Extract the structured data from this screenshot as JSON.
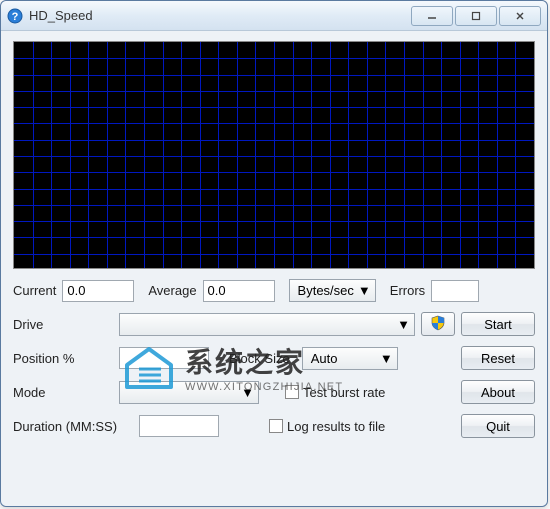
{
  "window": {
    "title": "HD_Speed"
  },
  "stats": {
    "current_label": "Current",
    "current_value": "0.0",
    "average_label": "Average",
    "average_value": "0.0",
    "units_label": "Bytes/sec",
    "errors_label": "Errors",
    "errors_value": ""
  },
  "drive": {
    "label": "Drive",
    "selected": ""
  },
  "position": {
    "label": "Position %",
    "value": ""
  },
  "blocksize": {
    "label": "Block Size",
    "selected": "Auto"
  },
  "mode": {
    "label": "Mode",
    "selected": ""
  },
  "testburst": {
    "label": "Test burst rate",
    "checked": false
  },
  "logresults": {
    "label": "Log results to file",
    "checked": false
  },
  "duration": {
    "label": "Duration (MM:SS)",
    "value": ""
  },
  "buttons": {
    "start": "Start",
    "reset": "Reset",
    "about": "About",
    "quit": "Quit"
  },
  "watermark": {
    "cn": "系统之家",
    "en": "WWW.XITONGZHIJIA.NET"
  }
}
